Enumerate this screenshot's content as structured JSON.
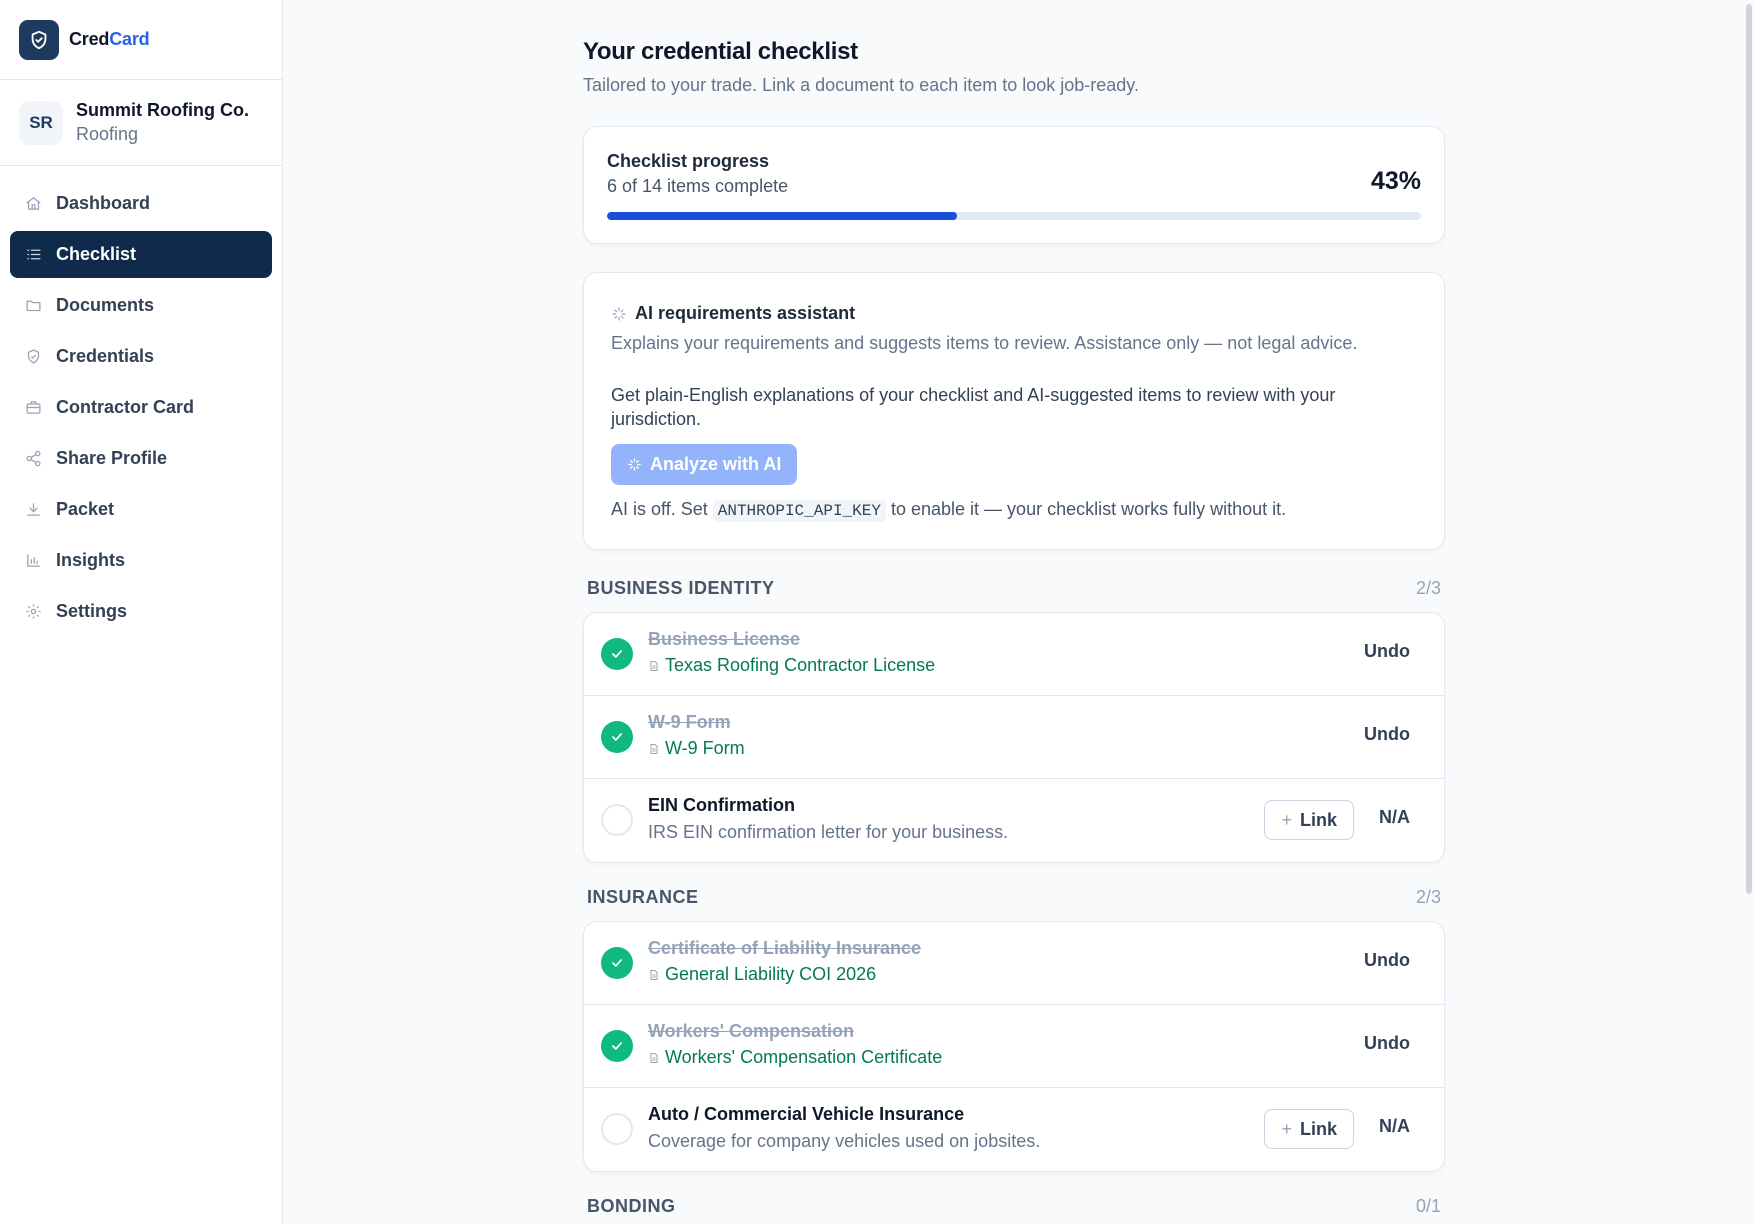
{
  "brand": {
    "name_part1": "Cred",
    "name_part2": "Card",
    "logo_icon": "shield-check-icon",
    "accent": "#2563eb"
  },
  "account": {
    "initials": "SR",
    "name": "Summit Roofing Co.",
    "trade": "Roofing"
  },
  "nav": {
    "items": [
      {
        "label": "Dashboard",
        "icon": "home-icon",
        "active": false
      },
      {
        "label": "Checklist",
        "icon": "list-icon",
        "active": true
      },
      {
        "label": "Documents",
        "icon": "folder-icon",
        "active": false
      },
      {
        "label": "Credentials",
        "icon": "shield-icon",
        "active": false
      },
      {
        "label": "Contractor Card",
        "icon": "id-card-icon",
        "active": false
      },
      {
        "label": "Share Profile",
        "icon": "share-icon",
        "active": false
      },
      {
        "label": "Packet",
        "icon": "download-icon",
        "active": false
      },
      {
        "label": "Insights",
        "icon": "bar-chart-icon",
        "active": false
      },
      {
        "label": "Settings",
        "icon": "gear-icon",
        "active": false
      }
    ]
  },
  "page": {
    "title": "Your credential checklist",
    "subtitle": "Tailored to your trade. Link a document to each item to look job-ready."
  },
  "progress": {
    "label": "Checklist progress",
    "detail": "6 of 14 items complete",
    "percent_text": "43%",
    "fraction": 0.43,
    "fill_color": "#1d4ed8"
  },
  "ai": {
    "title": "AI requirements assistant",
    "description": "Explains your requirements and suggests items to review. Assistance only — not legal advice.",
    "body": "Get plain-English explanations of your checklist and AI-suggested items to review with your jurisdiction.",
    "button_label": "Analyze with AI",
    "off_prefix": "AI is off. Set",
    "off_code": "ANTHROPIC_API_KEY",
    "off_suffix": "to enable it — your checklist works fully without it."
  },
  "actions": {
    "undo": "Undo",
    "link": "Link",
    "na": "N/A"
  },
  "sections": [
    {
      "title": "BUSINESS IDENTITY",
      "count": "2/3",
      "items": [
        {
          "title": "Business License",
          "done": true,
          "doc": "Texas Roofing Contractor License"
        },
        {
          "title": "W-9 Form",
          "done": true,
          "doc": "W-9 Form"
        },
        {
          "title": "EIN Confirmation",
          "done": false,
          "desc": "IRS EIN confirmation letter for your business."
        }
      ]
    },
    {
      "title": "INSURANCE",
      "count": "2/3",
      "items": [
        {
          "title": "Certificate of Liability Insurance",
          "done": true,
          "doc": "General Liability COI 2026"
        },
        {
          "title": "Workers' Compensation",
          "done": true,
          "doc": "Workers' Compensation Certificate"
        },
        {
          "title": "Auto / Commercial Vehicle Insurance",
          "done": false,
          "desc": "Coverage for company vehicles used on jobsites."
        }
      ]
    },
    {
      "title": "BONDING",
      "count": "0/1",
      "items": []
    }
  ]
}
